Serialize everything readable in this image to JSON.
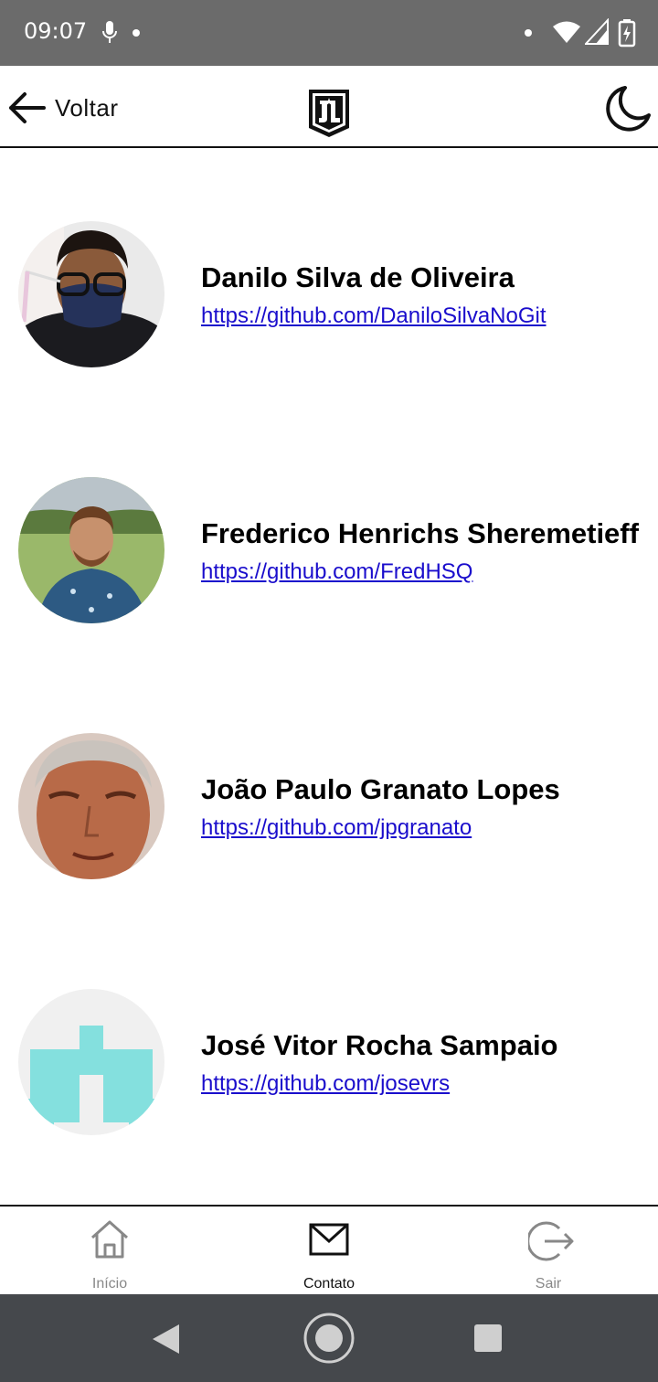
{
  "status_bar": {
    "time": "09:07"
  },
  "header": {
    "back_label": "Voltar",
    "logo_icon": "justice-league-logo",
    "theme_icon": "moon-icon"
  },
  "members": [
    {
      "name": "Danilo Silva de Oliveira",
      "url": "https://github.com/DaniloSilvaNoGit"
    },
    {
      "name": "Frederico Henrichs Sheremetieff",
      "url": "https://github.com/FredHSQ"
    },
    {
      "name": "João Paulo Granato Lopes",
      "url": "https://github.com/jpgranato"
    },
    {
      "name": "José Vitor Rocha Sampaio",
      "url": "https://github.com/josevrs"
    }
  ],
  "bottom_nav": {
    "items": [
      {
        "label": "Início",
        "icon": "home-icon",
        "color": "#888888"
      },
      {
        "label": "Contato",
        "icon": "mail-icon",
        "color": "#111111"
      },
      {
        "label": "Sair",
        "icon": "logout-icon",
        "color": "#888888"
      }
    ]
  },
  "colors": {
    "accent_link": "#1a0dcc",
    "status_bar": "#6b6b6b",
    "system_nav": "#45484c",
    "identicon": "#84e0de"
  }
}
